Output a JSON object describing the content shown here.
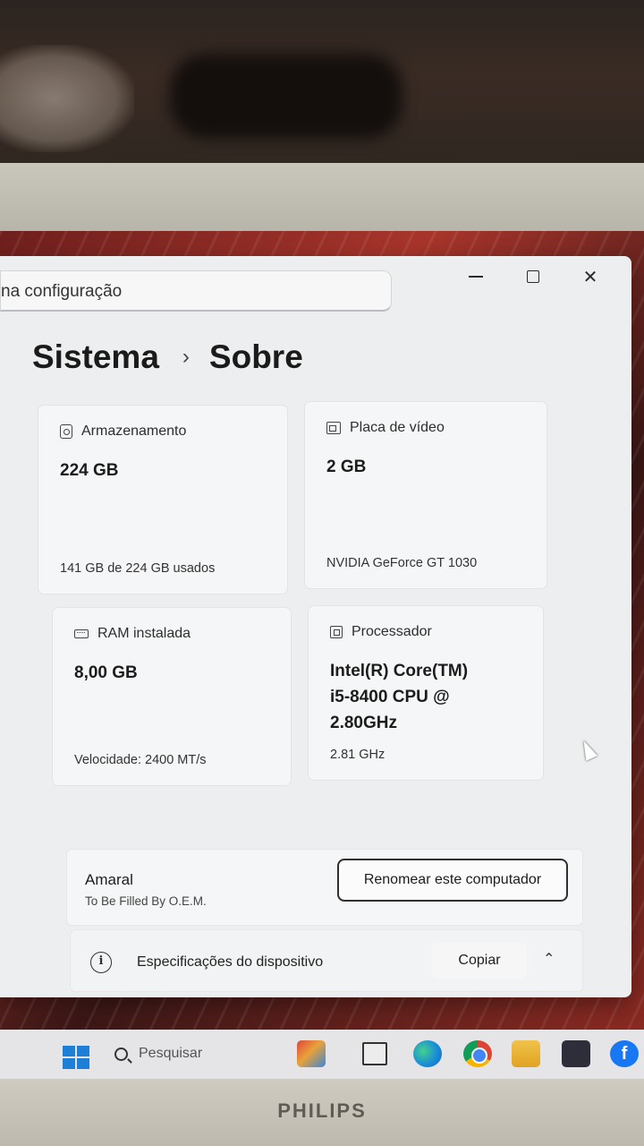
{
  "window": {
    "search_text": "na configuração",
    "controls": {
      "minimize": "–",
      "close": "✕"
    }
  },
  "breadcrumb": {
    "parent": "Sistema",
    "separator": "›",
    "current": "Sobre"
  },
  "cards": {
    "storage": {
      "title": "Armazenamento",
      "value": "224 GB",
      "footer": "141 GB de 224 GB usados"
    },
    "gpu": {
      "title": "Placa de vídeo",
      "value": "2 GB",
      "footer": "NVIDIA GeForce GT 1030"
    },
    "ram": {
      "title": "RAM instalada",
      "value": "8,00 GB",
      "footer": "Velocidade: 2400 MT/s"
    },
    "cpu": {
      "title": "Processador",
      "value_lines": [
        "Intel(R) Core(TM)",
        "i5-8400 CPU @",
        "2.80GHz"
      ],
      "footer": "2.81 GHz"
    }
  },
  "device": {
    "name": "Amaral",
    "oem": "To Be Filled By O.E.M.",
    "rename_label": "Renomear este computador"
  },
  "specs": {
    "label": "Especificações do dispositivo",
    "copy_label": "Copiar",
    "info_glyph": "i",
    "collapse_glyph": "⌃"
  },
  "taskbar": {
    "search_placeholder": "Pesquisar",
    "facebook_glyph": "f"
  },
  "monitor": {
    "brand": "PHILIPS"
  },
  "colors": {
    "window_bg": "#edeeef",
    "card_bg": "#f5f6f7",
    "start_blue": "#1e7fd6"
  }
}
